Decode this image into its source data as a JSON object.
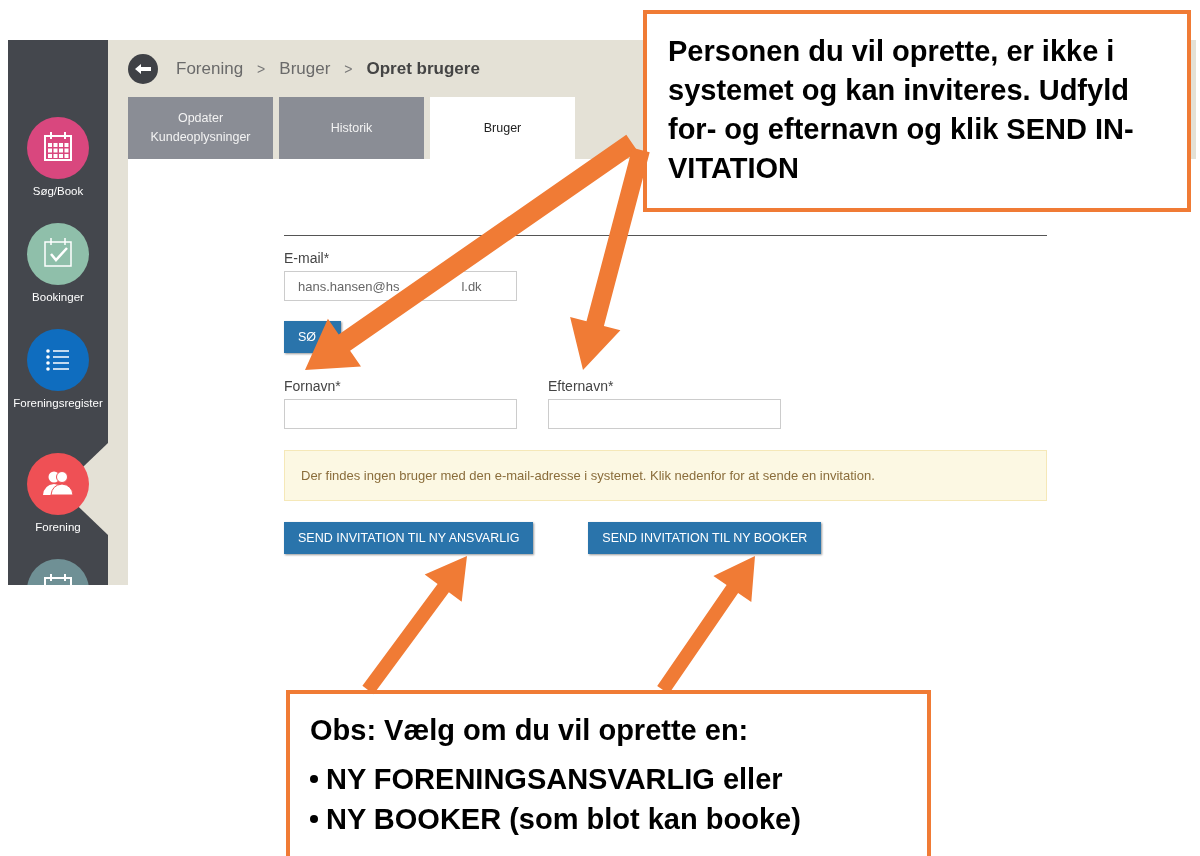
{
  "sidebar": {
    "items": [
      {
        "label": "Søg/Book",
        "kind": "grid",
        "color": "#d9477e",
        "selected": false
      },
      {
        "label": "Bookinger",
        "kind": "check",
        "color": "#8fbfaa",
        "selected": false
      },
      {
        "label": "Foreningsregister",
        "kind": "list",
        "color": "#0f6dbf",
        "selected": false
      },
      {
        "label": "Forening",
        "kind": "people",
        "color": "#ef5055",
        "selected": true
      },
      {
        "kind": "grid",
        "color": "#6f9095",
        "selected": false
      }
    ]
  },
  "breadcrumb": [
    "Forening",
    "Bruger",
    "Opret brugere"
  ],
  "breadcrumb_separator": ">",
  "tabs": [
    {
      "label": "Opdater Kundeoplysninger",
      "selected": false
    },
    {
      "label": "Historik",
      "selected": false
    },
    {
      "label": "Bruger",
      "selected": true
    }
  ],
  "form": {
    "email": {
      "label": "E-mail*",
      "value_start": "hans.hansen@hs",
      "value_end": "l.dk"
    },
    "search_button": "SØ",
    "first_name": {
      "label": "Fornavn*"
    },
    "last_name": {
      "label": "Efternavn*"
    },
    "alert": "Der findes ingen bruger med den e-mail-adresse i systemet. Klik nedenfor for at sende en invitation.",
    "buttons": [
      "SEND INVITATION TIL NY ANSVARLIG",
      "SEND INVITATION TIL NY BOOKER"
    ]
  },
  "callouts": [
    {
      "text": "Personen du vil oprette, er ikke i systemet og kan inviteres. Udfyld for- og efternavn og klik SEND IN-VITATION"
    },
    {
      "text": "Obs: Vælg om du vil oprette en:",
      "bullets": [
        "NY FORENINGSANSVARLIG eller",
        "NY BOOKER (som blot kan booke)"
      ]
    }
  ]
}
